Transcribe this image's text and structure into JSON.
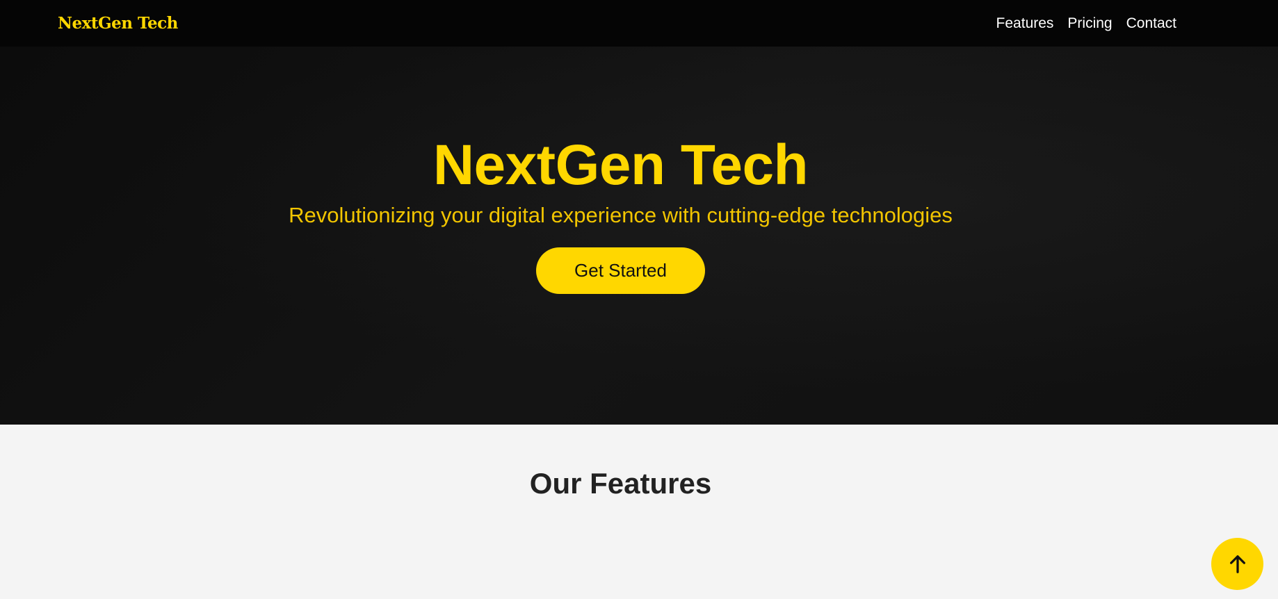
{
  "nav": {
    "brand": "NextGen Tech",
    "links": [
      "Features",
      "Pricing",
      "Contact"
    ]
  },
  "hero": {
    "title": "NextGen Tech",
    "subtitle": "Revolutionizing your digital experience with cutting-edge technologies",
    "cta_label": "Get Started"
  },
  "features": {
    "title": "Our Features"
  },
  "scroll_top": {
    "icon": "arrow-up-icon"
  },
  "colors": {
    "accent": "#ffd700",
    "nav_bg": "#050505",
    "hero_bg": "#121212",
    "section_bg": "#f4f4f4",
    "nav_text": "#ffffff",
    "heading_text": "#222222"
  }
}
